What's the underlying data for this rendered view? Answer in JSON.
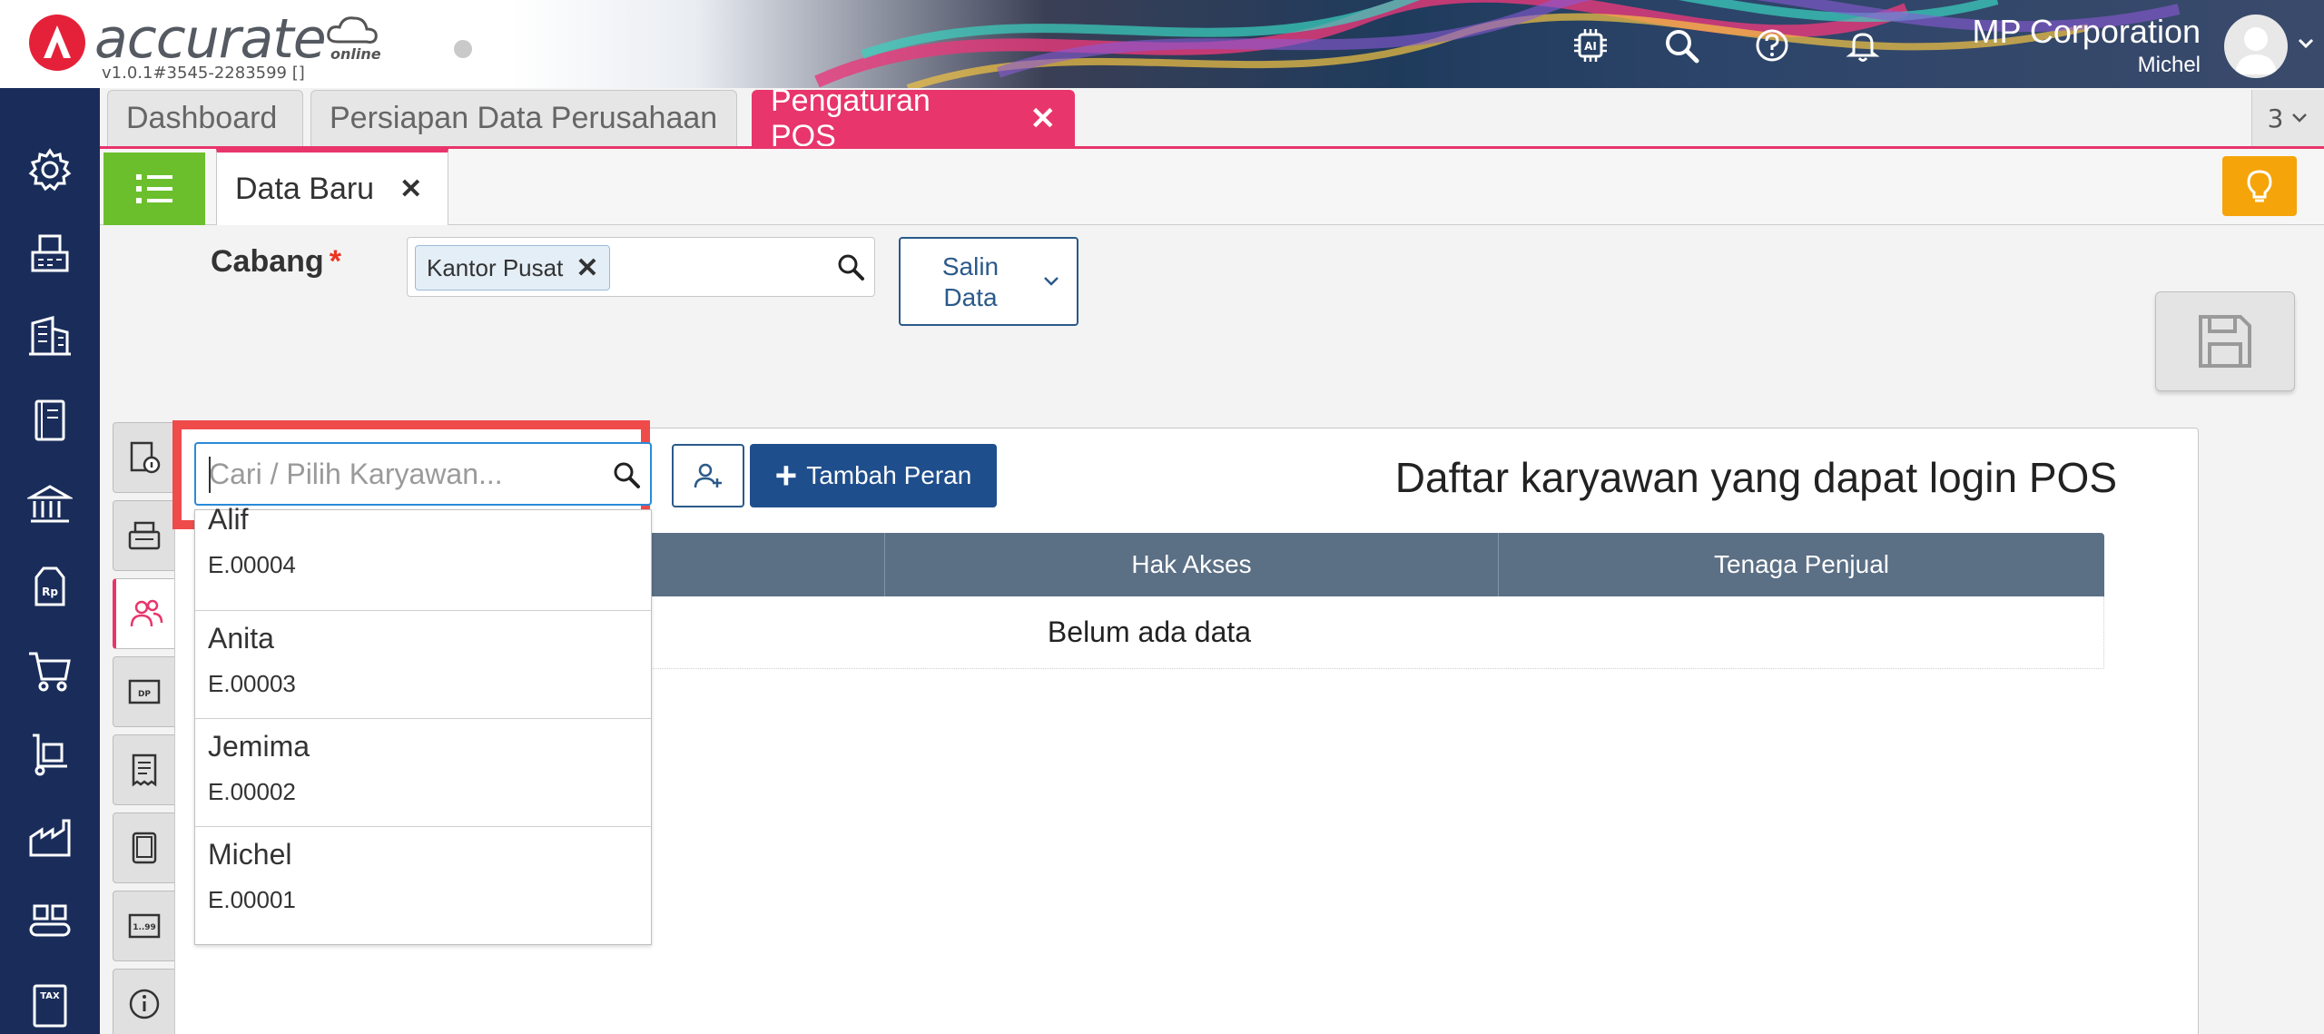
{
  "header": {
    "logo_text": "accurate",
    "logo_sub": "online",
    "version": "v1.0.1#3545-2283599 []",
    "company_name": "MP Corporation",
    "user_name": "Michel"
  },
  "tabs": [
    {
      "label": "Dashboard"
    },
    {
      "label": "Persiapan Data Perusahaan"
    },
    {
      "label": "Pengaturan POS"
    }
  ],
  "tab_count": "3",
  "subtab": {
    "label": "Data Baru"
  },
  "form": {
    "cabang_label": "Cabang",
    "required_mark": "*",
    "cabang_value": "Kantor Pusat",
    "salin_line1": "Salin",
    "salin_line2": "Data"
  },
  "panel": {
    "search_placeholder": "Cari / Pilih Karyawan...",
    "add_role_label": "Tambah Peran",
    "title": "Daftar karyawan yang dapat login POS",
    "columns": [
      "",
      "Hak Akses",
      "Tenaga Penjual"
    ],
    "empty_text": "Belum ada data"
  },
  "dropdown": [
    {
      "name": "Alif",
      "code": "E.00004"
    },
    {
      "name": "Anita",
      "code": "E.00003"
    },
    {
      "name": "Jemima",
      "code": "E.00002"
    },
    {
      "name": "Michel",
      "code": "E.00001"
    }
  ],
  "colors": {
    "accent_pink": "#e8356b",
    "nav_bg": "#1a2d5a",
    "primary_blue": "#1f4e8c",
    "highlight_red": "#f04b4b",
    "list_green": "#6bbf2c",
    "bulb_orange": "#f5a40a"
  }
}
